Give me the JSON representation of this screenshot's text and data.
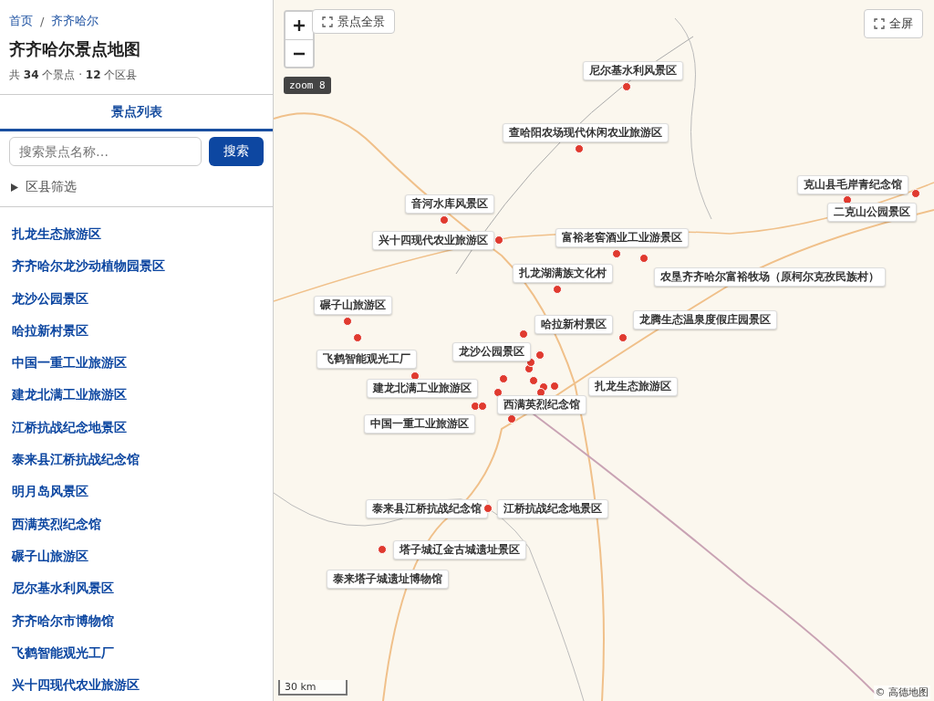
{
  "breadcrumb": [
    {
      "label": "首页"
    },
    {
      "label": "齐齐哈尔"
    }
  ],
  "breadcrumb_separator": "/",
  "title": "齐齐哈尔景点地图",
  "summary": "共 **34** 个景点 · **12** 个区县",
  "tabs": [
    {
      "label": "景点列表",
      "selected": true
    }
  ],
  "search": {
    "placeholder": "搜索景点名称…",
    "button": "搜索"
  },
  "filter": {
    "label": "区县筛选",
    "expanded": false
  },
  "attractions": [
    "扎龙生态旅游区",
    "齐齐哈尔龙沙动植物园景区",
    "龙沙公园景区",
    "哈拉新村景区",
    "中国一重工业旅游区",
    "建龙北满工业旅游区",
    "江桥抗战纪念地景区",
    "泰来县江桥抗战纪念馆",
    "明月岛风景区",
    "西满英烈纪念馆",
    "碾子山旅游区",
    "尼尔基水利风景区",
    "齐齐哈尔市博物馆",
    "飞鹤智能观光工厂",
    "兴十四现代农业旅游区"
  ],
  "map": {
    "overview_button": "景点全景",
    "zoom_badge": "zoom 8",
    "fullscreen_button": "全屏",
    "scale": "30 km",
    "attribution": "© 高德地图",
    "markers": [
      {
        "label": "尼尔基水利风景区"
      },
      {
        "label": "查哈阳农场现代休闲农业旅游区"
      },
      {
        "label": "克山县毛岸青纪念馆"
      },
      {
        "label": "二克山公园景区"
      },
      {
        "label": "音河水库风景区"
      },
      {
        "label": "兴十四现代农业旅游区"
      },
      {
        "label": "富裕老窖酒业工业游景区"
      },
      {
        "label": "扎龙湖满族文化村"
      },
      {
        "label": "农垦齐齐哈尔富裕牧场（原柯尔克孜民族村）"
      },
      {
        "label": "碾子山旅游区"
      },
      {
        "label": "哈拉新村景区"
      },
      {
        "label": "龙腾生态温泉度假庄园景区"
      },
      {
        "label": "飞鹤智能观光工厂"
      },
      {
        "label": "龙沙公园景区"
      },
      {
        "label": "建龙北满工业旅游区"
      },
      {
        "label": "扎龙生态旅游区"
      },
      {
        "label": "西满英烈纪念馆"
      },
      {
        "label": "中国一重工业旅游区"
      },
      {
        "label": "泰来县江桥抗战纪念馆"
      },
      {
        "label": "江桥抗战纪念地景区"
      },
      {
        "label": "塔子城辽金古城遗址景区"
      },
      {
        "label": "泰来塔子城遗址博物馆"
      }
    ]
  }
}
